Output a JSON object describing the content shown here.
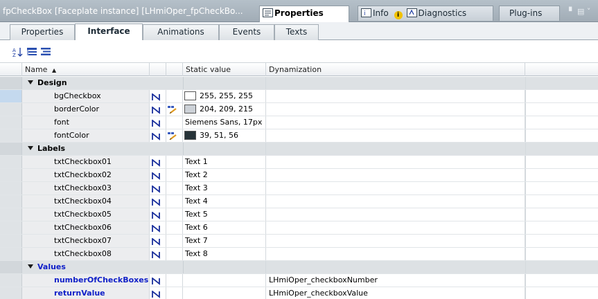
{
  "title_bar": {
    "title": "fpCheckBox [Faceplate instance] [LHmiOper_fpCheckBo...",
    "tabs": [
      {
        "label": "Properties",
        "active": true,
        "icon": "properties-icon"
      },
      {
        "label": "Info",
        "active": false,
        "icon": "info-icon"
      },
      {
        "label": "Diagnostics",
        "active": false,
        "icon": "diagnostics-icon"
      },
      {
        "label": "Plug-ins",
        "active": false,
        "icon": ""
      }
    ]
  },
  "sub_tabs": [
    "Properties",
    "Interface",
    "Animations",
    "Events",
    "Texts"
  ],
  "active_sub_tab": "Interface",
  "toolbar": {
    "icons": [
      "sort-az-icon",
      "expand-tree-icon",
      "collapse-tree-icon"
    ]
  },
  "grid": {
    "columns": {
      "name": "Name",
      "static_value": "Static value",
      "dynamization": "Dynamization"
    },
    "sort_indicator": "▲",
    "rows": [
      {
        "type": "group",
        "label": "Design",
        "blue": false
      },
      {
        "type": "item",
        "name": "bgCheckbox",
        "static": "255, 255, 255",
        "swatch": "#ffffff",
        "edit": false,
        "dyn": "",
        "selected": true
      },
      {
        "type": "item",
        "name": "borderColor",
        "static": "204, 209, 215",
        "swatch": "#ccd1d7",
        "edit": true,
        "dyn": ""
      },
      {
        "type": "item",
        "name": "font",
        "static": "Siemens Sans, 17px",
        "swatch": "",
        "edit": false,
        "dyn": ""
      },
      {
        "type": "item",
        "name": "fontColor",
        "static": "39, 51, 56",
        "swatch": "#273338",
        "edit": true,
        "dyn": ""
      },
      {
        "type": "group",
        "label": "Labels",
        "blue": false
      },
      {
        "type": "item",
        "name": "txtCheckbox01",
        "static": "Text 1",
        "swatch": "",
        "edit": false,
        "dyn": ""
      },
      {
        "type": "item",
        "name": "txtCheckbox02",
        "static": "Text 2",
        "swatch": "",
        "edit": false,
        "dyn": ""
      },
      {
        "type": "item",
        "name": "txtCheckbox03",
        "static": "Text 3",
        "swatch": "",
        "edit": false,
        "dyn": ""
      },
      {
        "type": "item",
        "name": "txtCheckbox04",
        "static": "Text 4",
        "swatch": "",
        "edit": false,
        "dyn": ""
      },
      {
        "type": "item",
        "name": "txtCheckbox05",
        "static": "Text 5",
        "swatch": "",
        "edit": false,
        "dyn": ""
      },
      {
        "type": "item",
        "name": "txtCheckbox06",
        "static": "Text 6",
        "swatch": "",
        "edit": false,
        "dyn": ""
      },
      {
        "type": "item",
        "name": "txtCheckbox07",
        "static": "Text 7",
        "swatch": "",
        "edit": false,
        "dyn": ""
      },
      {
        "type": "item",
        "name": "txtCheckbox08",
        "static": "Text 8",
        "swatch": "",
        "edit": false,
        "dyn": ""
      },
      {
        "type": "group",
        "label": "Values",
        "blue": true
      },
      {
        "type": "item",
        "name": "numberOfCheckBoxes",
        "static": "",
        "swatch": "",
        "edit": false,
        "dyn": "LHmiOper_checkboxNumber",
        "blue": true
      },
      {
        "type": "item",
        "name": "returnValue",
        "static": "",
        "swatch": "",
        "edit": false,
        "dyn": "LHmiOper_checkboxValue",
        "blue": true
      }
    ]
  },
  "colors": {
    "accent_blue": "#1020c8",
    "dynamization_icon": "#1a2f9c",
    "titlebar": "#a9b4be"
  }
}
